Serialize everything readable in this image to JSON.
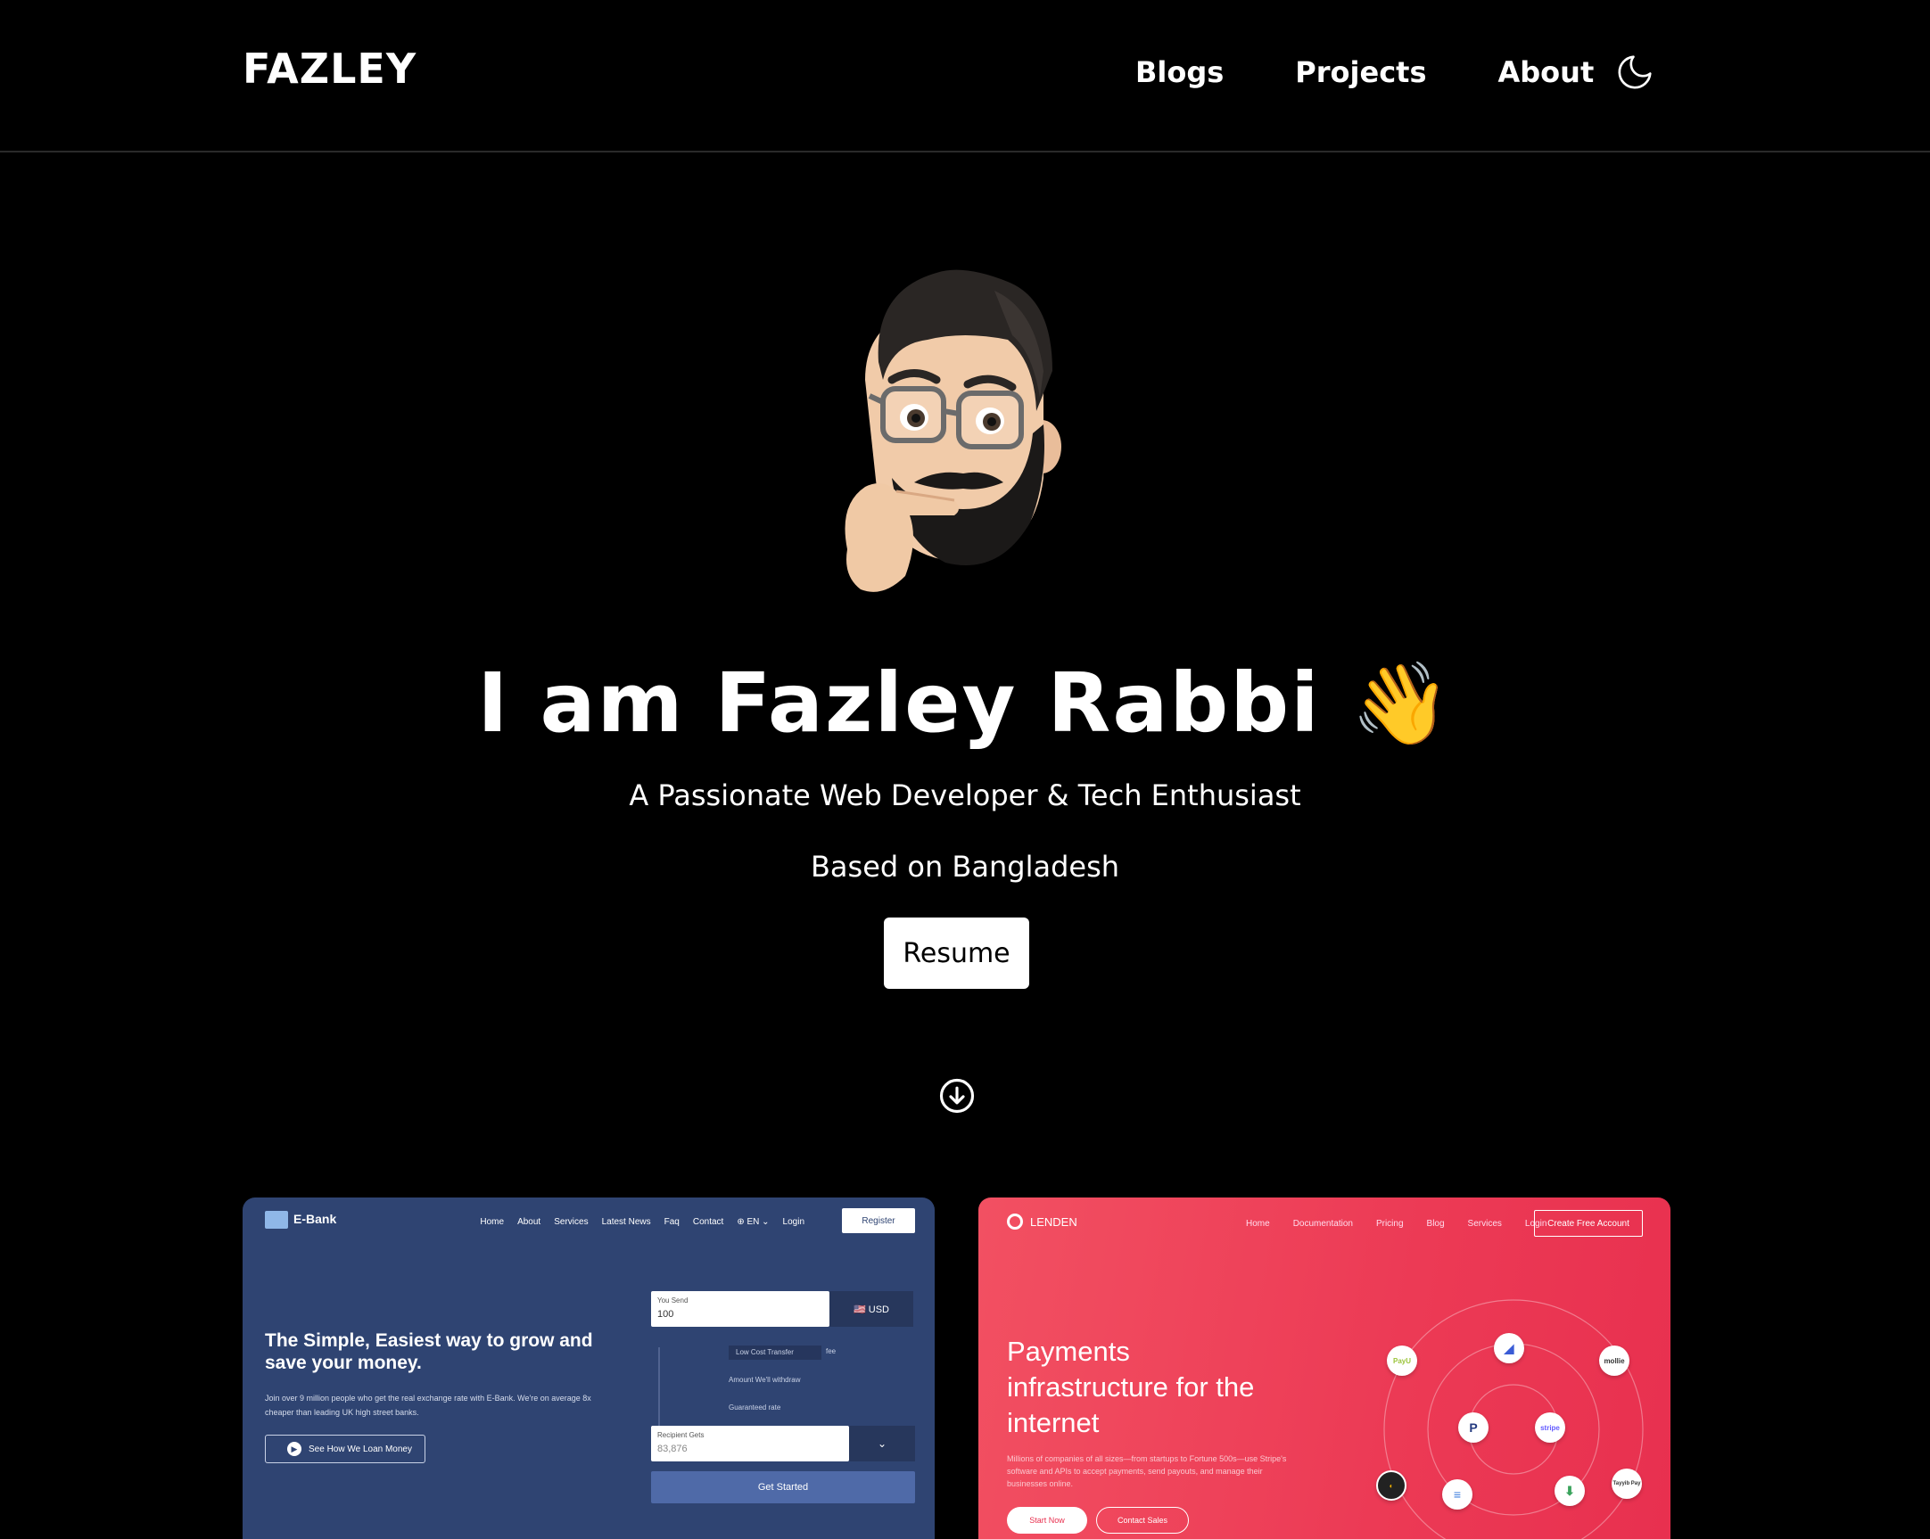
{
  "header": {
    "logo": "FAZLEY",
    "nav": [
      "Blogs",
      "Projects",
      "About"
    ]
  },
  "hero": {
    "title": "I am Fazley Rabbi",
    "wave_emoji": "👋",
    "subtitle": "A Passionate Web Developer & Tech Enthusiast",
    "location": "Based on Bangladesh",
    "resume_label": "Resume"
  },
  "projects": [
    {
      "brand": "E-Bank",
      "nav": [
        "Home",
        "About",
        "Services",
        "Latest News",
        "Faq",
        "Contact",
        "⊕ EN ⌄",
        "Login"
      ],
      "register": "Register",
      "headline": "The Simple, Easiest way to grow and save your money.",
      "desc": "Join over 9 million people who get the real exchange rate with E-Bank. We're on average 8x cheaper than leading UK high street banks.",
      "cta": "See How We Loan Money",
      "send_label": "You Send",
      "send_value": "100",
      "currency": "🇺🇸 USD",
      "transfer": "Low Cost Transfer",
      "fee": "fee",
      "withdraw": "Amount We'll withdraw",
      "rate": "Guaranteed rate",
      "recipient_label": "Recipient Gets",
      "recipient_value": "83,876",
      "get_started": "Get Started"
    },
    {
      "brand": "LENDEN",
      "nav": [
        "Home",
        "Documentation",
        "Pricing",
        "Blog",
        "Services",
        "Login"
      ],
      "create": "Create Free Account",
      "headline": "Payments infrastructure for the internet",
      "desc": "Millions of companies of all sizes—from startups to Fortune 500s—use Stripe's software and APIs to accept payments, send payouts, and manage their businesses online.",
      "start": "Start Now",
      "contact": "Contact Sales",
      "partners": [
        "PayU",
        "mollie",
        "stripe",
        "Tayyib Pay"
      ]
    }
  ],
  "colors": {
    "background": "#000000",
    "ebank": "#2f4472",
    "lenden": "#ec3a55"
  },
  "icons": [
    "moon-icon",
    "arrow-down-circle-icon",
    "memoji-avatar",
    "waving-hand-emoji"
  ]
}
